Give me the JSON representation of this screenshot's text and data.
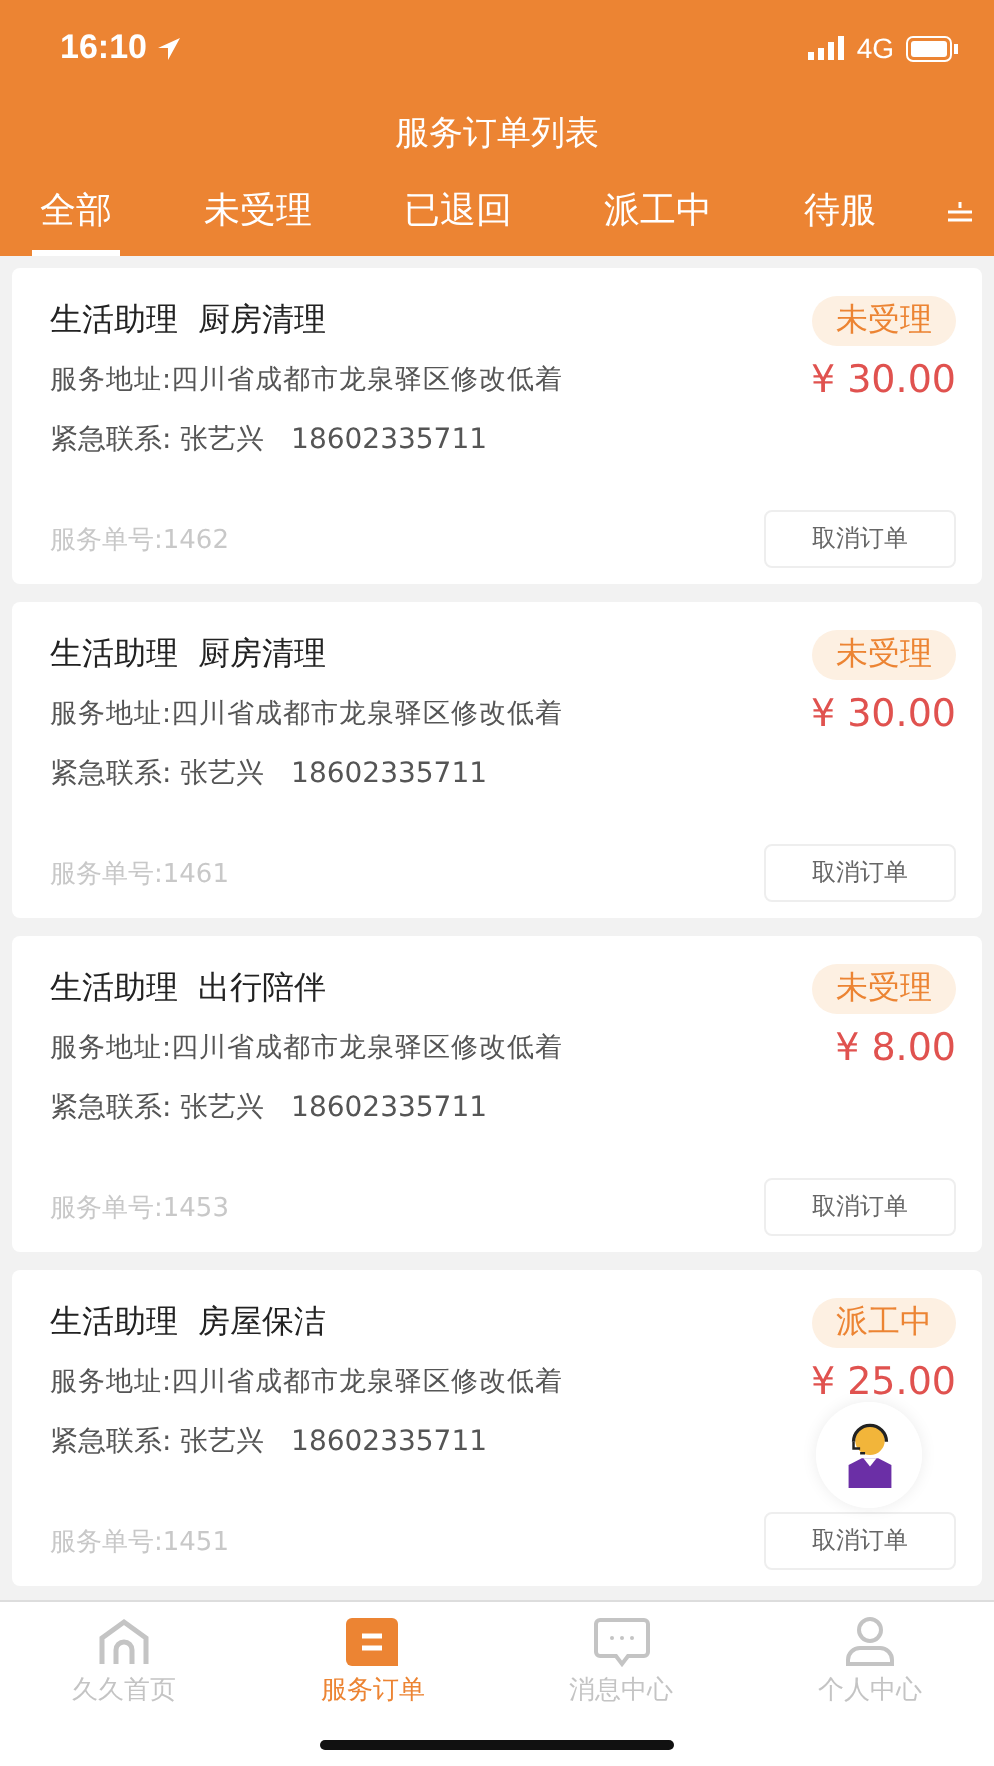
{
  "status_bar": {
    "time": "16:10",
    "network": "4G"
  },
  "header": {
    "title": "服务订单列表"
  },
  "tabs": [
    {
      "label": "全部",
      "selected": true
    },
    {
      "label": "未受理",
      "selected": false
    },
    {
      "label": "已退回",
      "selected": false
    },
    {
      "label": "派工中",
      "selected": false
    },
    {
      "label": "待服",
      "selected": false
    }
  ],
  "orders": [
    {
      "category": "生活助理",
      "service": "厨房清理",
      "status": "未受理",
      "address": "服务地址:四川省成都市龙泉驿区修改低着",
      "price": "¥ 30.00",
      "contact_label": "紧急联系: 张艺兴",
      "phone": "18602335711",
      "order_no": "服务单号:1462",
      "action": "取消订单"
    },
    {
      "category": "生活助理",
      "service": "厨房清理",
      "status": "未受理",
      "address": "服务地址:四川省成都市龙泉驿区修改低着",
      "price": "¥ 30.00",
      "contact_label": "紧急联系: 张艺兴",
      "phone": "18602335711",
      "order_no": "服务单号:1461",
      "action": "取消订单"
    },
    {
      "category": "生活助理",
      "service": "出行陪伴",
      "status": "未受理",
      "address": "服务地址:四川省成都市龙泉驿区修改低着",
      "price": "¥ 8.00",
      "contact_label": "紧急联系: 张艺兴",
      "phone": "18602335711",
      "order_no": "服务单号:1453",
      "action": "取消订单"
    },
    {
      "category": "生活助理",
      "service": "房屋保洁",
      "status": "派工中",
      "address": "服务地址:四川省成都市龙泉驿区修改低着",
      "price": "¥ 25.00",
      "contact_label": "紧急联系: 张艺兴",
      "phone": "18602335711",
      "order_no": "服务单号:1451",
      "action": "取消订单"
    }
  ],
  "bottom_nav": [
    {
      "label": "久久首页",
      "kind": "home",
      "selected": false
    },
    {
      "label": "服务订单",
      "kind": "orders",
      "selected": true
    },
    {
      "label": "消息中心",
      "kind": "messages",
      "selected": false
    },
    {
      "label": "个人中心",
      "kind": "profile",
      "selected": false
    }
  ]
}
